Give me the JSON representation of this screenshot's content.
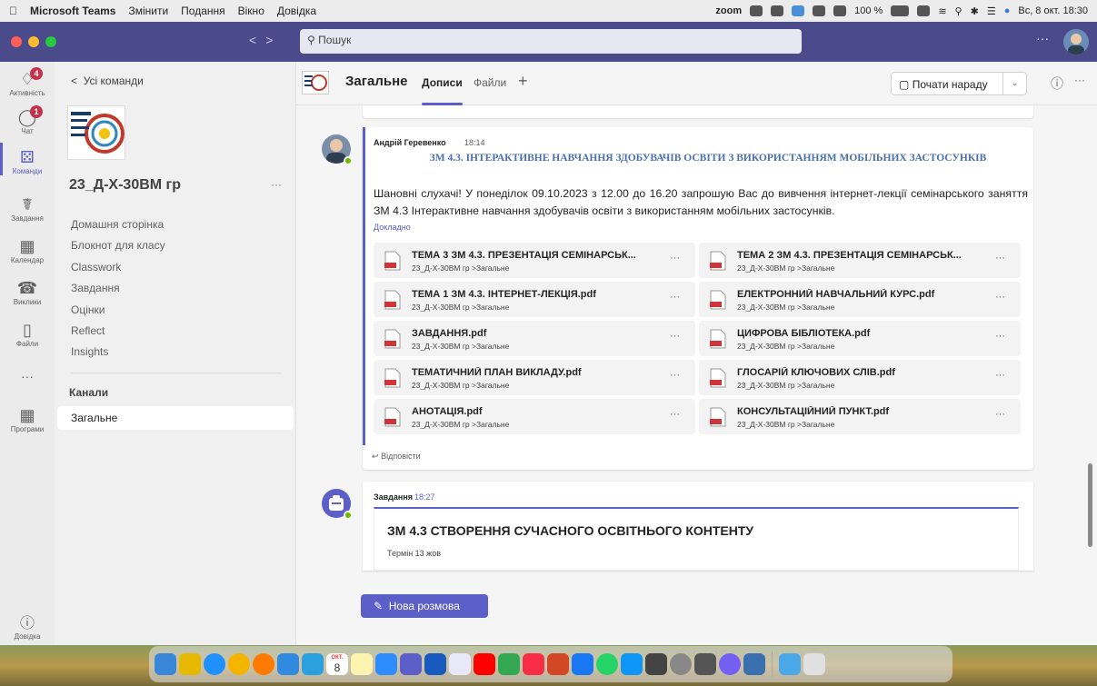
{
  "menubar": {
    "app": "Microsoft Teams",
    "items": [
      "Змінити",
      "Подання",
      "Вікно",
      "Довідка"
    ],
    "zoom": "zoom",
    "battery": "100 %",
    "datetime": "Вс, 8 окт. 18:30"
  },
  "titlebar": {
    "search_placeholder": "Пошук",
    "more": "···"
  },
  "rail": {
    "activity": {
      "label": "Активність",
      "badge": "4"
    },
    "chat": {
      "label": "Чат",
      "badge": "1"
    },
    "teams": {
      "label": "Команди"
    },
    "assignments": {
      "label": "Завдання"
    },
    "calendar": {
      "label": "Календар"
    },
    "calls": {
      "label": "Виклики"
    },
    "files": {
      "label": "Файли"
    },
    "more": "···",
    "apps": {
      "label": "Програми"
    },
    "help": {
      "label": "Довідка"
    }
  },
  "sidebar": {
    "back_label": "Усі команди",
    "team_name": "23_Д-Х-30ВМ гр",
    "team_more": "···",
    "items": [
      "Домашня сторінка",
      "Блокнот для класу",
      "Classwork",
      "Завдання",
      "Оцінки",
      "Reflect",
      "Insights"
    ],
    "channels_heading": "Канали",
    "channel": "Загальне"
  },
  "channel_header": {
    "title": "Загальне",
    "tab_posts": "Дописи",
    "tab_files": "Файли",
    "tab_add": "+",
    "meet_button": "Почати нараду",
    "more": "···"
  },
  "post1": {
    "author": "Андрій Геревенко",
    "time": "18:14",
    "title": "ЗМ 4.3. ІНТЕРАКТИВНЕ НАВЧАННЯ ЗДОБУВАЧІВ ОСВІТИ З ВИКОРИСТАННЯМ МОБІЛЬНИХ ЗАСТОСУНКІВ",
    "body": "Шановні слухачі! У понеділок 09.10.2023 з 12.00 до 16.20 запрошую Вас до вивчення інтернет-лекції семінарського заняття ЗМ 4.3 Інтерактивне навчання здобувачів освіти з використанням мобільних застосунків.",
    "more_link": "Докладно",
    "attachments": [
      {
        "name": "ТЕМА 3 ЗМ 4.3. ПРЕЗЕНТАЦІЯ СЕМІНАРСЬК...",
        "location": "23_Д-Х-30ВМ гр >Загальне"
      },
      {
        "name": "ТЕМА 2 ЗМ 4.3. ПРЕЗЕНТАЦІЯ СЕМІНАРСЬК...",
        "location": "23_Д-Х-30ВМ гр >Загальне"
      },
      {
        "name": "ТЕМА 1 ЗМ 4.3. ІНТЕРНЕТ-ЛЕКЦІЯ.pdf",
        "location": "23_Д-Х-30ВМ гр >Загальне"
      },
      {
        "name": "ЕЛЕКТРОННИЙ НАВЧАЛЬНИЙ КУРС.pdf",
        "location": "23_Д-Х-30ВМ гр >Загальне"
      },
      {
        "name": "ЗАВДАННЯ.pdf",
        "location": "23_Д-Х-30ВМ гр >Загальне"
      },
      {
        "name": "ЦИФРОВА БІБЛІОТЕКА.pdf",
        "location": "23_Д-Х-30ВМ гр >Загальне"
      },
      {
        "name": "ТЕМАТИЧНИЙ ПЛАН ВИКЛАДУ.pdf",
        "location": "23_Д-Х-30ВМ гр >Загальне"
      },
      {
        "name": "ГЛОСАРІЙ КЛЮЧОВИХ СЛІВ.pdf",
        "location": "23_Д-Х-30ВМ гр >Загальне"
      },
      {
        "name": "АНОТАЦІЯ.pdf",
        "location": "23_Д-Х-30ВМ гр >Загальне"
      },
      {
        "name": "КОНСУЛЬТАЦІЙНИЙ ПУНКТ.pdf",
        "location": "23_Д-Х-30ВМ гр >Загальне"
      }
    ],
    "attachment_more": "···",
    "reply": "Відповісти"
  },
  "post2": {
    "author": "Завдання",
    "time": "18:27",
    "card_title": "ЗМ 4.3 СТВОРЕННЯ СУЧАСНОГО ОСВІТНЬОГО КОНТЕНТУ",
    "due": "Термін 13 жов"
  },
  "new_conversation": "Нова розмова",
  "dock": {
    "calendar_month": "ОКТ.",
    "calendar_day": "8"
  },
  "colors": {
    "accent": "#5b5fc7",
    "titlebar": "#4b4a8a",
    "badge": "#c4314b",
    "presence": "#6bb700",
    "pdf": "#d13438"
  }
}
